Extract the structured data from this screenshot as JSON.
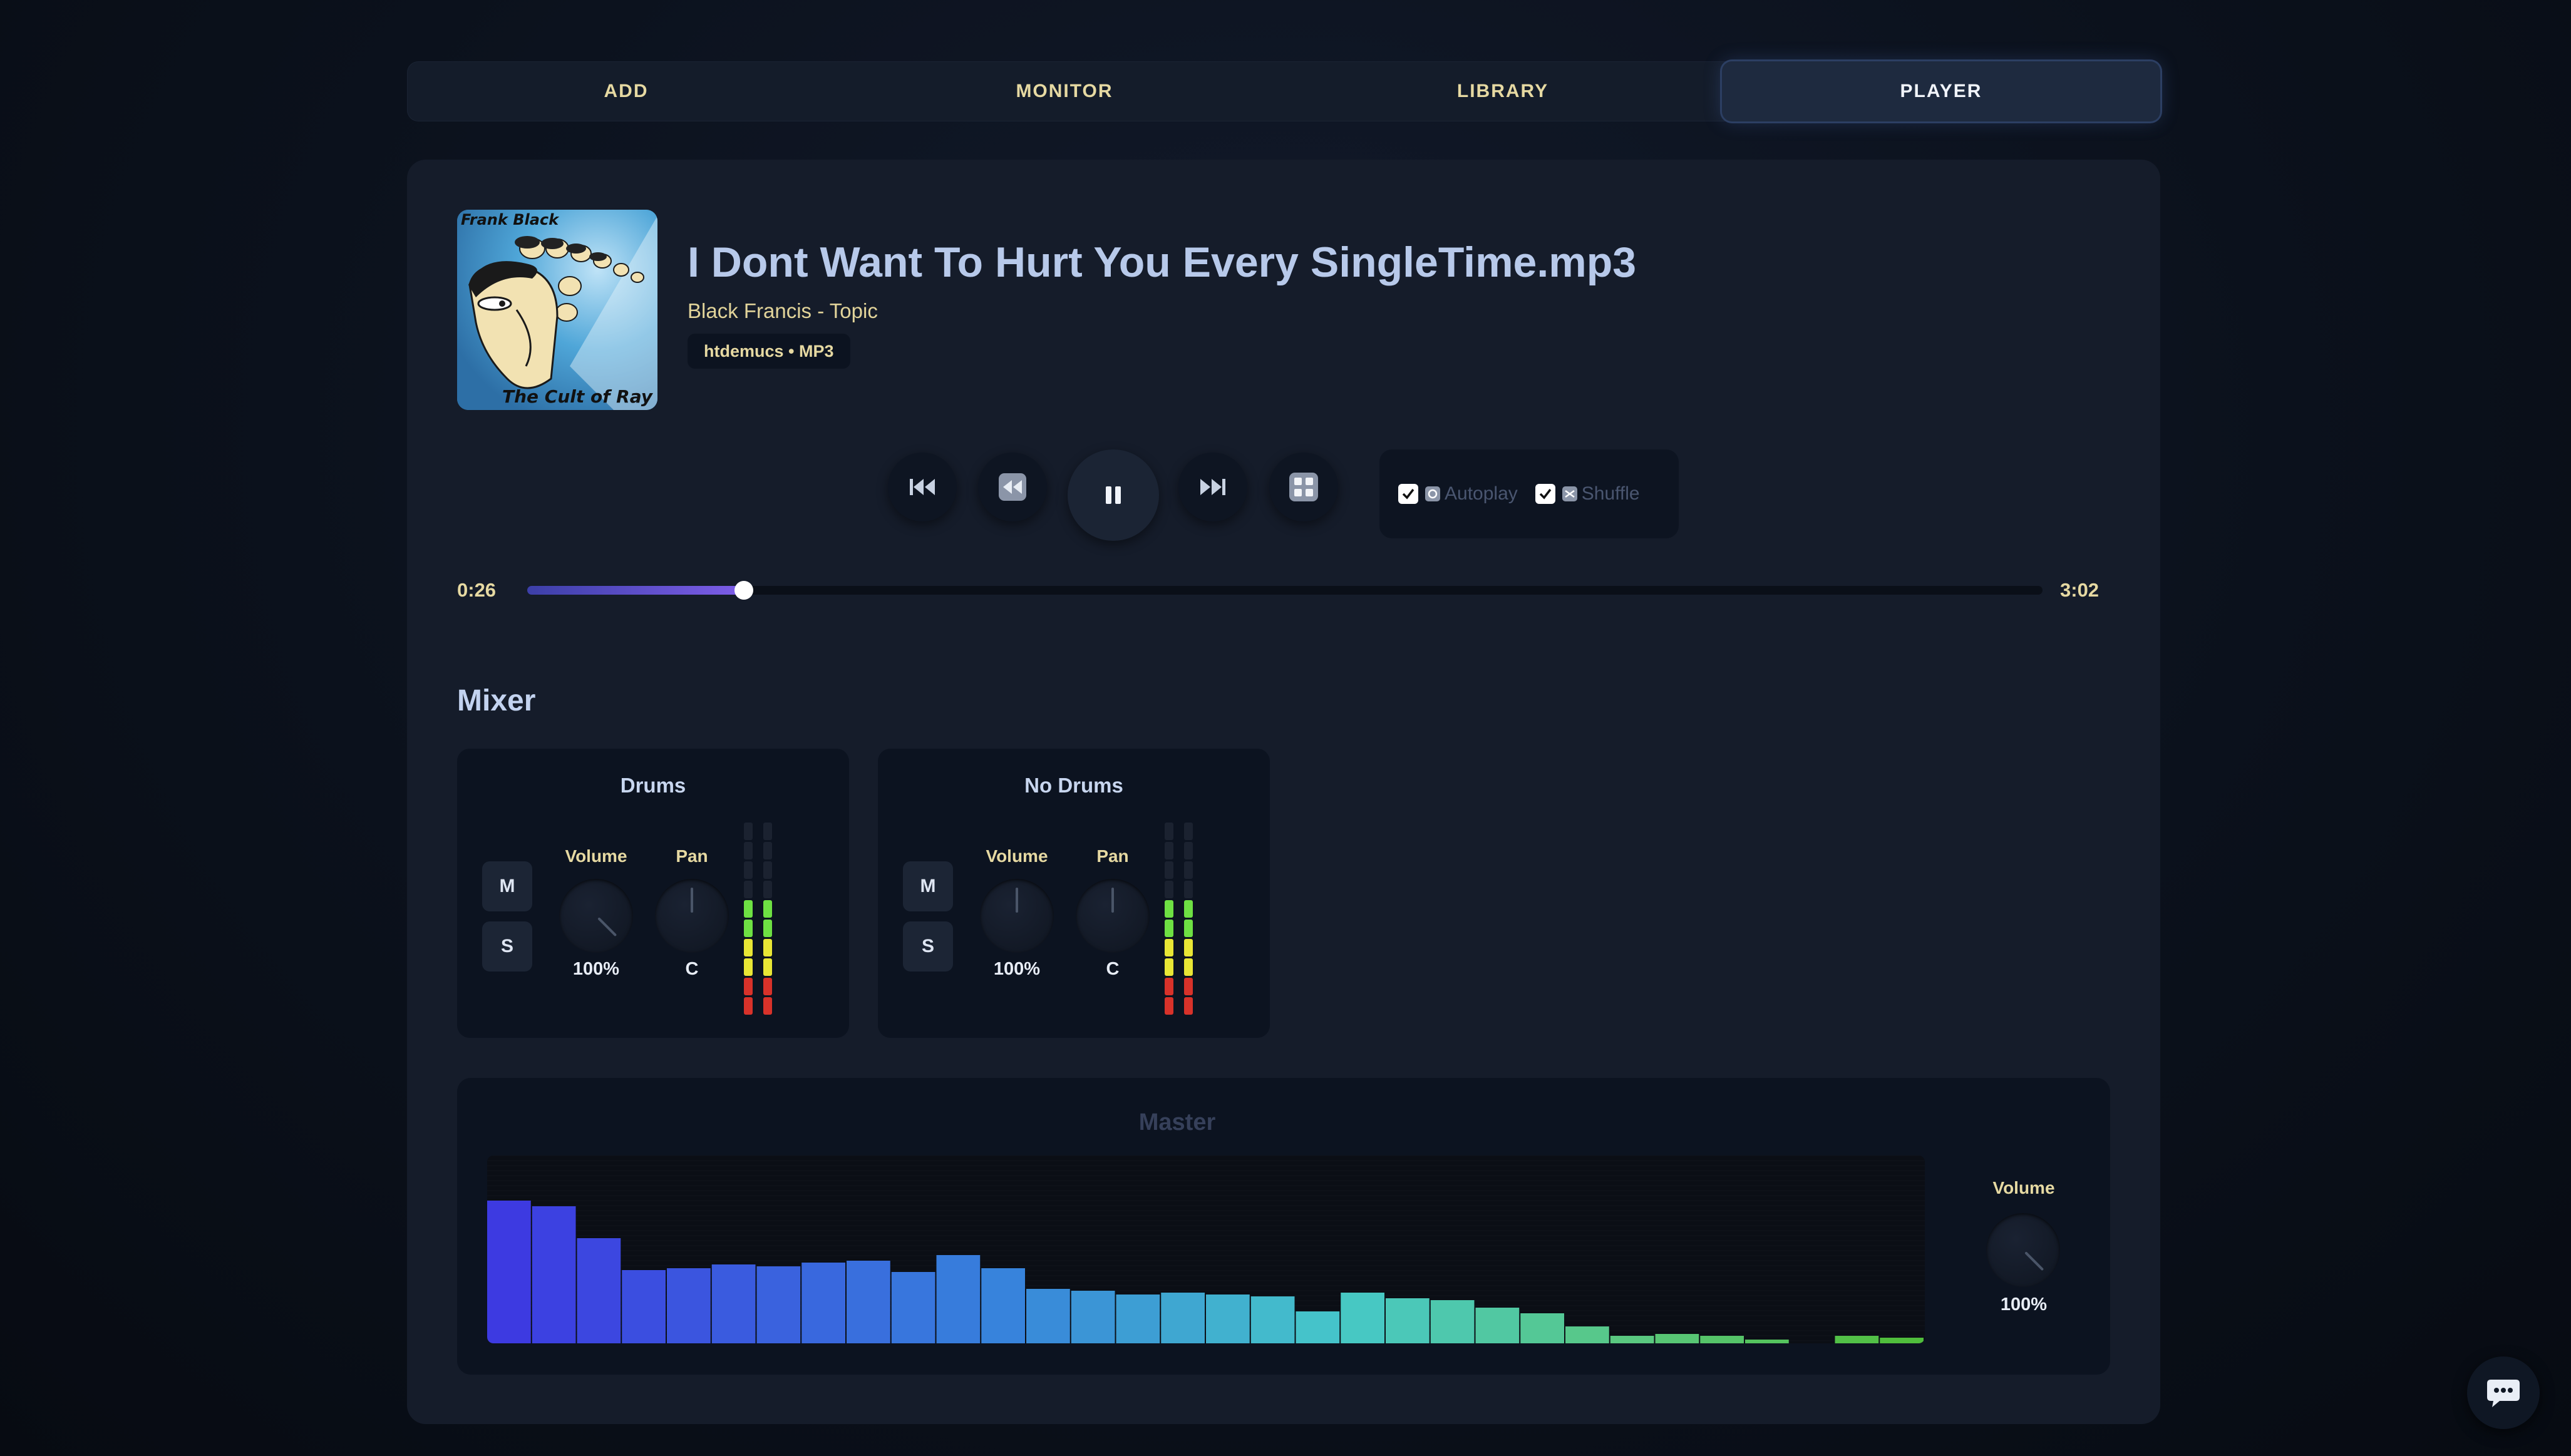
{
  "tabs": [
    {
      "label": "ADD",
      "active": false
    },
    {
      "label": "MONITOR",
      "active": false
    },
    {
      "label": "LIBRARY",
      "active": false
    },
    {
      "label": "PLAYER",
      "active": true
    }
  ],
  "track": {
    "title": "I Dont Want To Hurt You Every SingleTime.mp3",
    "artist": "Black Francis - Topic",
    "badge": "htdemucs • MP3",
    "art_top_text": "Frank Black",
    "art_bottom_text": "The Cult of Ray"
  },
  "controls": {
    "icons": [
      "skip-previous-icon",
      "rewind-icon",
      "pause-icon",
      "skip-next-icon",
      "grid-icon"
    ],
    "autoplay": {
      "label": "Autoplay",
      "checked": true
    },
    "shuffle": {
      "label": "Shuffle",
      "checked": true
    }
  },
  "progress": {
    "elapsed": "0:26",
    "duration": "3:02",
    "fraction": 0.143
  },
  "mixer": {
    "title": "Mixer",
    "mute_label": "M",
    "solo_label": "S",
    "volume_label": "Volume",
    "pan_label": "Pan",
    "channels": [
      {
        "name": "Drums",
        "volume": "100%",
        "pan": "C",
        "meter_levels": [
          0.58,
          0.58
        ]
      },
      {
        "name": "No Drums",
        "volume": "100%",
        "pan": "C",
        "meter_levels": [
          0.58,
          0.58
        ]
      }
    ]
  },
  "master": {
    "title": "Master",
    "volume_label": "Volume",
    "volume": "100%",
    "spectrum_levels": [
      0.76,
      0.73,
      0.56,
      0.39,
      0.4,
      0.42,
      0.41,
      0.43,
      0.44,
      0.38,
      0.47,
      0.4,
      0.29,
      0.28,
      0.26,
      0.27,
      0.26,
      0.25,
      0.17,
      0.27,
      0.24,
      0.23,
      0.19,
      0.16,
      0.09,
      0.04,
      0.05,
      0.04,
      0.01,
      0,
      0.04,
      0.03
    ]
  },
  "colors": {
    "accent": "#7d5de8",
    "text_yellow": "#e6d9a2",
    "meter_green": "#6ee043",
    "meter_yellow": "#e8e635",
    "meter_red": "#d8322a"
  }
}
